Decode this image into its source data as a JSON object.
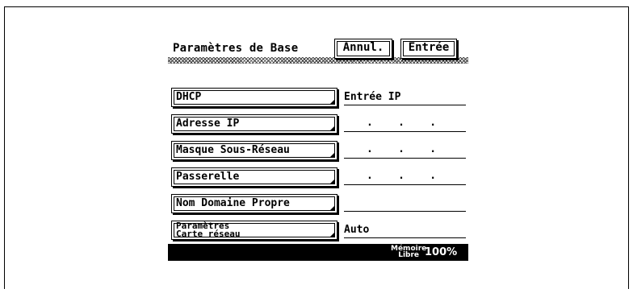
{
  "screen": {
    "title": "Paramètres de Base",
    "cancel_label": "Annul.",
    "enter_label": "Entrée"
  },
  "rows": [
    {
      "button": "DHCP",
      "value": "Entrée IP"
    },
    {
      "button": "Adresse IP",
      "value": ".    .    ."
    },
    {
      "button": "Masque Sous-Réseau",
      "value": ".    .    ."
    },
    {
      "button": "Passerelle",
      "value": ".    .    ."
    },
    {
      "button": "Nom Domaine Propre",
      "value": ""
    },
    {
      "button_line1": "Paramètres",
      "button_line2": "Carte réseau",
      "value": "Auto"
    }
  ],
  "status": {
    "memory_line1": "Mémoire",
    "memory_line2": "Libre",
    "memory_value": "100%"
  }
}
